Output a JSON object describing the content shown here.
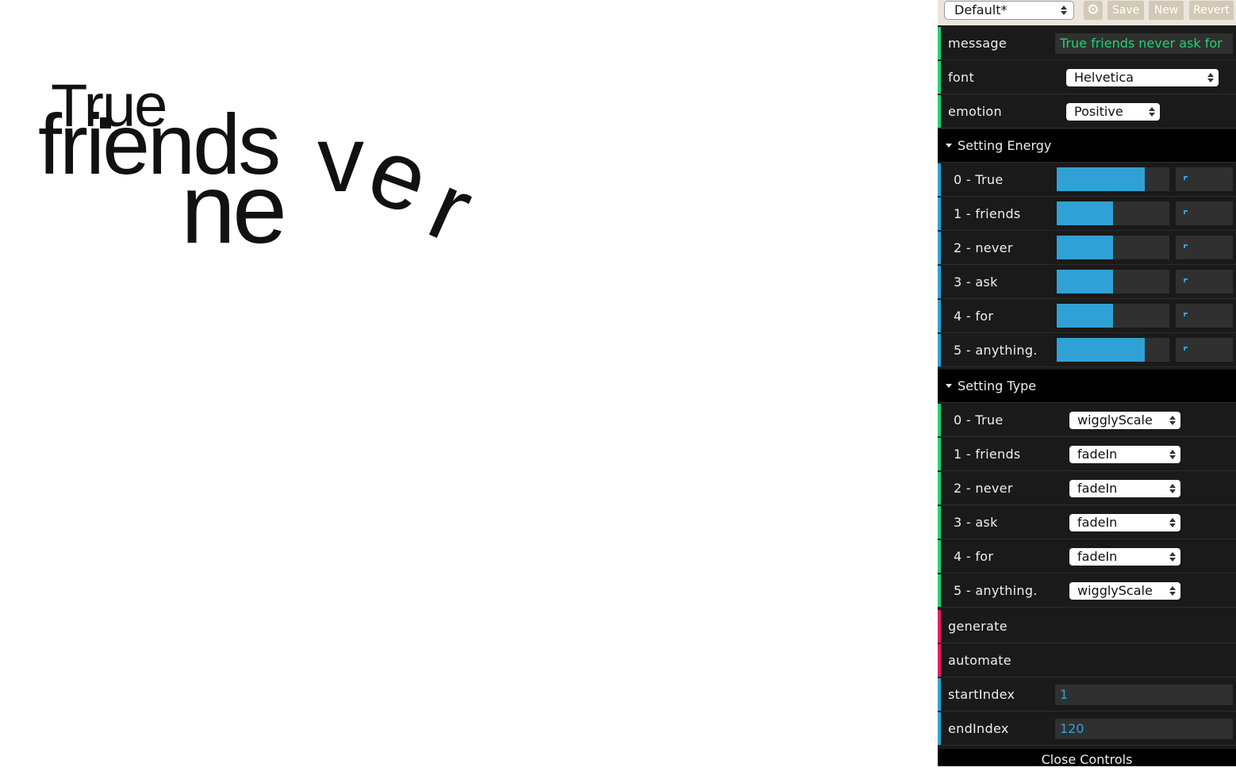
{
  "canvas": {
    "words": {
      "true": "True",
      "friends": "friends",
      "ne": "ne",
      "v": "v",
      "e": "e",
      "r": "r"
    }
  },
  "toolbar": {
    "preset": "Default*",
    "save_label": "Save",
    "new_label": "New",
    "revert_label": "Revert",
    "gear_icon": "gear-icon"
  },
  "controls": {
    "message": {
      "label": "message",
      "value": "True friends never ask for"
    },
    "font": {
      "label": "font",
      "value": "Helvetica"
    },
    "emotion": {
      "label": "emotion",
      "value": "Positive"
    }
  },
  "energy": {
    "title": "Setting Energy",
    "items": [
      {
        "label": "0 - True",
        "fill": 0.78
      },
      {
        "label": "1 - friends",
        "fill": 0.5
      },
      {
        "label": "2 - never",
        "fill": 0.5
      },
      {
        "label": "3 - ask",
        "fill": 0.5
      },
      {
        "label": "4 - for",
        "fill": 0.5
      },
      {
        "label": "5 - anything.",
        "fill": 0.78
      }
    ]
  },
  "type": {
    "title": "Setting Type",
    "items": [
      {
        "label": "0 - True",
        "value": "wigglyScale"
      },
      {
        "label": "1 - friends",
        "value": "fadeIn"
      },
      {
        "label": "2 - never",
        "value": "fadeIn"
      },
      {
        "label": "3 - ask",
        "value": "fadeIn"
      },
      {
        "label": "4 - for",
        "value": "fadeIn"
      },
      {
        "label": "5 - anything.",
        "value": "wigglyScale"
      }
    ]
  },
  "actions": {
    "generate": "generate",
    "automate": "automate"
  },
  "indices": {
    "start": {
      "label": "startIndex",
      "value": "1"
    },
    "end": {
      "label": "endIndex",
      "value": "120"
    }
  },
  "close_label": "Close Controls",
  "colors": {
    "panel_bg": "#1a1a1a",
    "string_accent": "#1ed36f",
    "number_accent": "#2fa1d6",
    "function_accent": "#e61d5f"
  }
}
